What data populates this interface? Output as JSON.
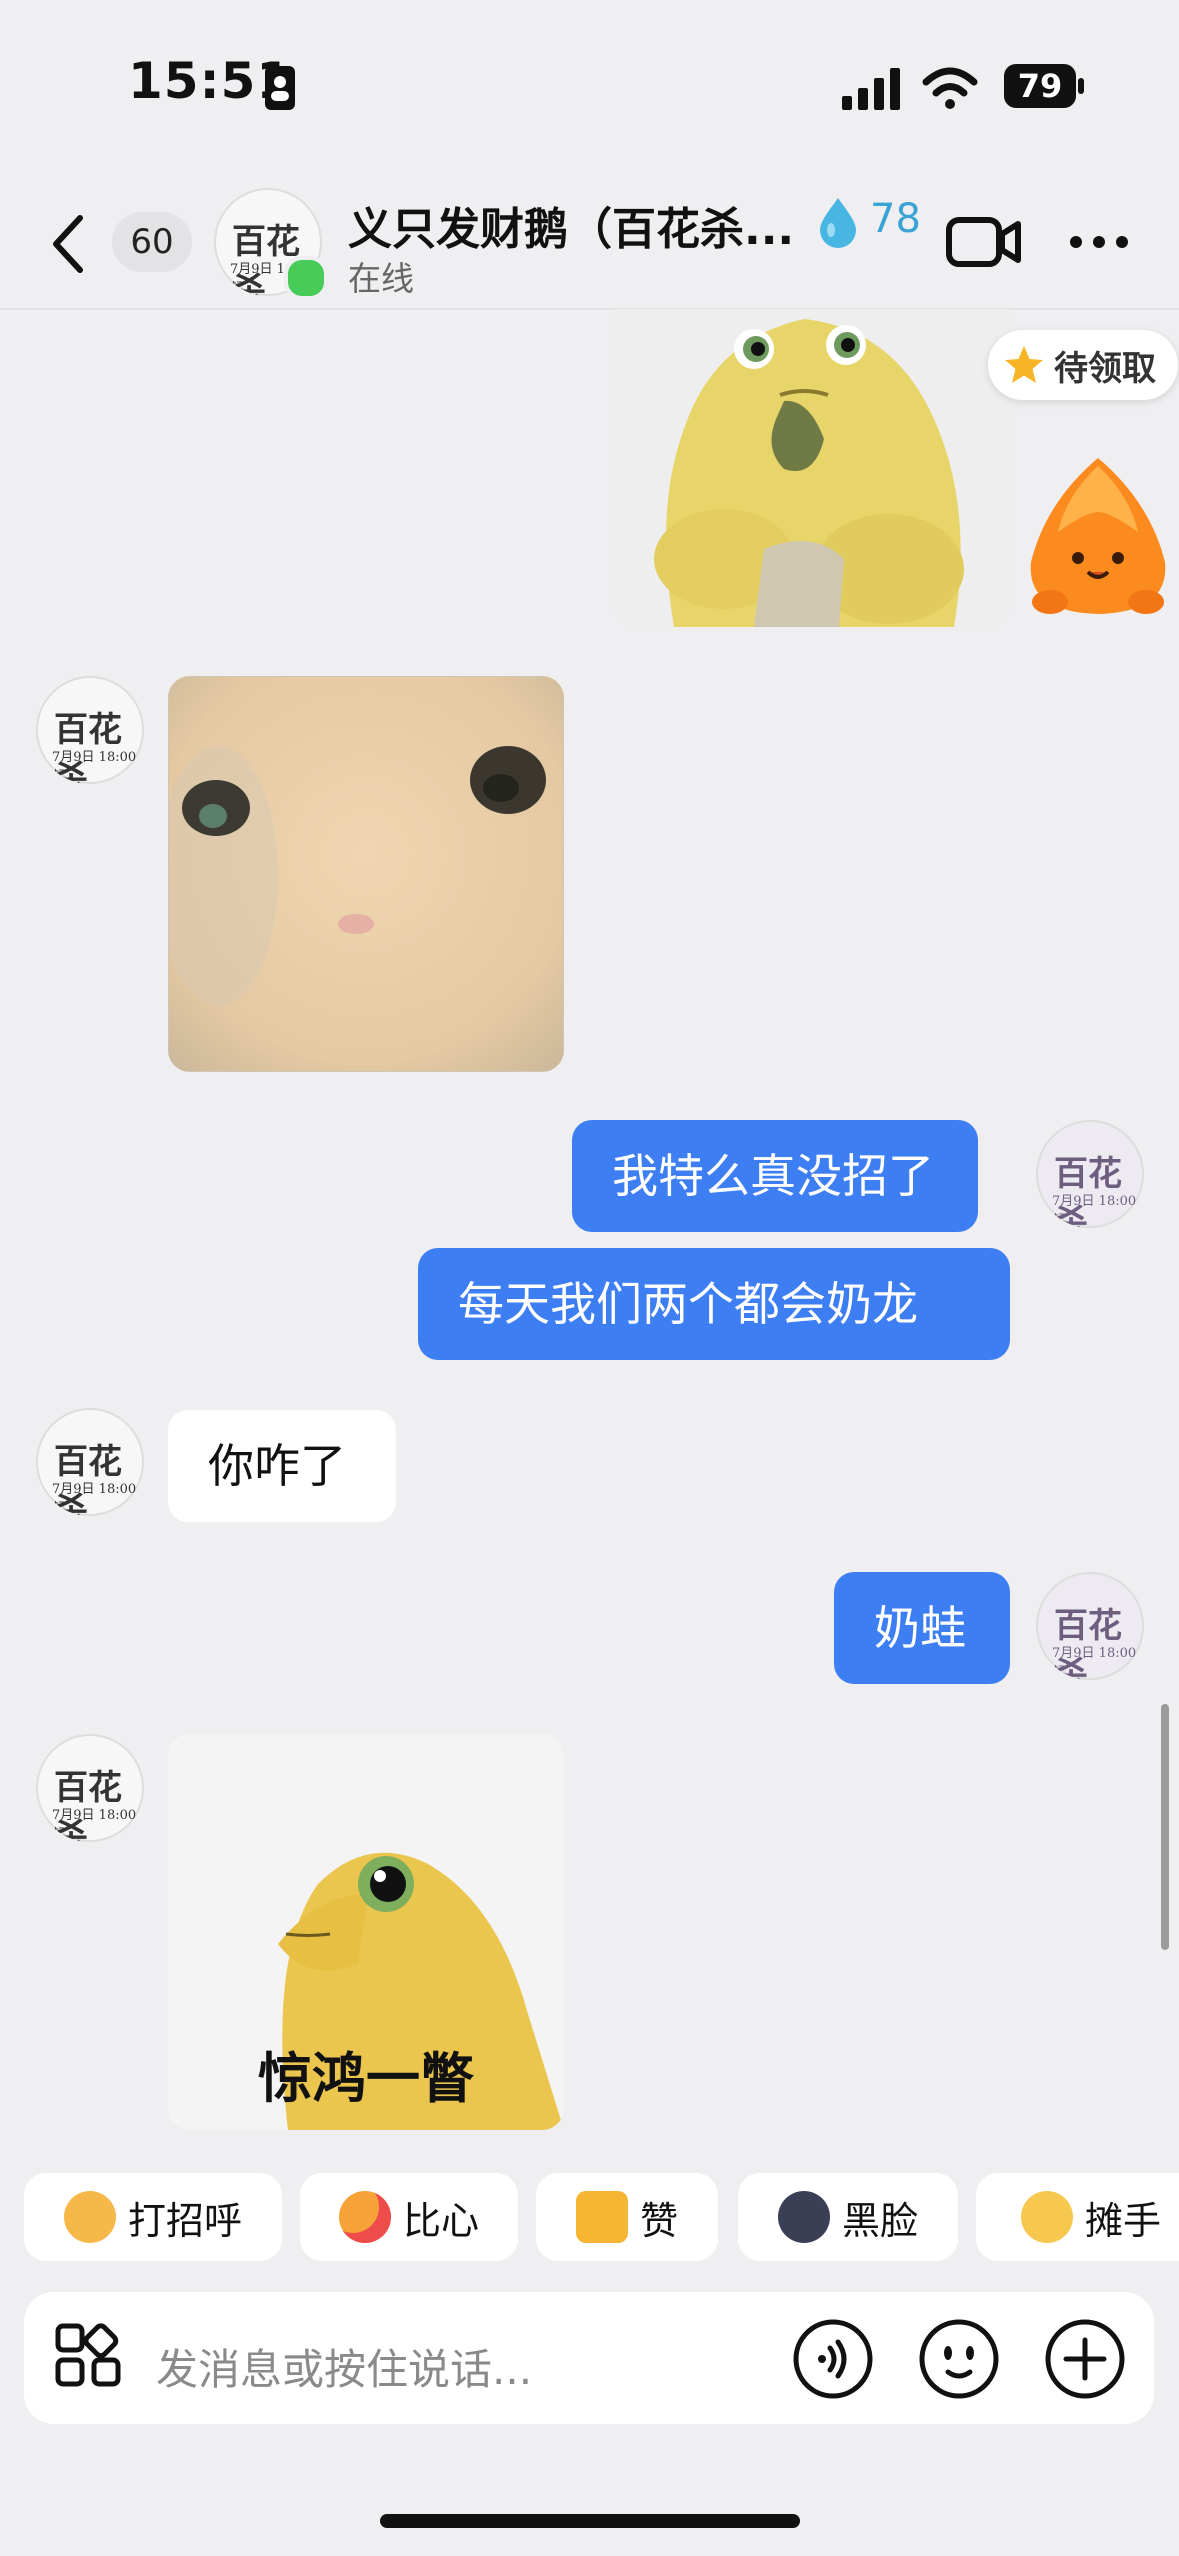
{
  "status_bar": {
    "time": "15:51",
    "battery": "79"
  },
  "header": {
    "unread_count": "60",
    "contact_name": "义只发财鹅（百花杀...",
    "status": "在线",
    "fire_count": "78"
  },
  "avatar_text": {
    "main": "百花杀",
    "date": "7月9日 18:00起"
  },
  "floating": {
    "reward_label": "待领取"
  },
  "messages": {
    "out_1": "我特么真没招了",
    "out_2": "每天我们两个都会奶龙",
    "in_1": "你咋了",
    "out_3": "奶蛙",
    "sticker_caption": "惊鸿一瞥"
  },
  "quick_reactions": [
    "打招呼",
    "比心",
    "赞",
    "黑脸",
    "摊手"
  ],
  "input": {
    "placeholder": "发消息或按住说话..."
  },
  "colors": {
    "accent": "#3d7ef3",
    "online": "#47cc5a",
    "background": "#efeff1"
  }
}
